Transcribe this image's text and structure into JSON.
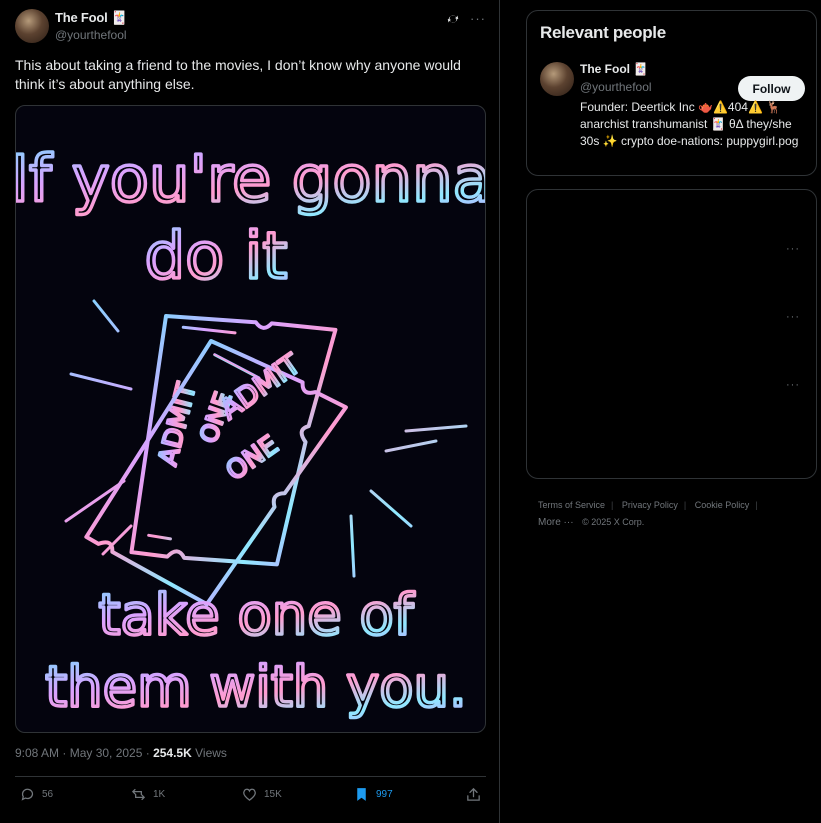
{
  "tweet": {
    "author_name": "The Fool 🃏",
    "author_handle": "@yourthefool",
    "text": "This about taking a friend to the movies, I don’t know why anyone would think it’s about anything else.",
    "image_text": {
      "line1": "If you're gonna",
      "line2": "do it",
      "ticket1_top": "ADMIT",
      "ticket1_bottom": "ONE",
      "ticket2_top": "ADMIT",
      "ticket2_bottom": "ONE",
      "line3": "take one of",
      "line4": "them with you."
    },
    "time": "9:08 AM · May 30, 2025 · ",
    "views_count": "254.5K",
    "views_label": " Views",
    "replies": "56",
    "reposts": "1K",
    "likes": "15K",
    "bookmarks": "997",
    "bookmark_color": "#1d9bf0"
  },
  "relevant_people": {
    "title": "Relevant people",
    "name": "The Fool 🃏",
    "handle": "@yourthefool",
    "follow_label": "Follow",
    "bio": "Founder: Deertick Inc 🫖⚠️404⚠️ 🦌 anarchist transhumanist 🃏 θΔ they/she 30s ✨ crypto doe-nations: puppygirl.pog"
  },
  "footer": {
    "terms": "Terms of Service",
    "privacy": "Privacy Policy",
    "cookie": "Cookie Policy",
    "more": "More ···",
    "copyright": "© 2025 X Corp."
  }
}
